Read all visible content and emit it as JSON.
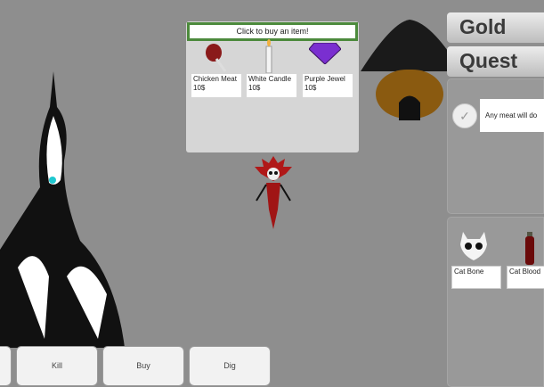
{
  "shop": {
    "title": "Click to buy an item!",
    "items": [
      {
        "label": "Chicken Meat 10$",
        "icon": "chicken-meat-icon"
      },
      {
        "label": "White Candle 10$",
        "icon": "white-candle-icon"
      },
      {
        "label": "Purple Jewel 10$",
        "icon": "purple-jewel-icon"
      }
    ]
  },
  "tabs": {
    "gold": "Gold",
    "quest": "Quest"
  },
  "quest": {
    "text": "Any meat will do",
    "icon": "checkmark-icon"
  },
  "inventory": [
    {
      "label": "Cat Bone",
      "icon": "cat-skull-icon"
    },
    {
      "label": "Cat Blood",
      "icon": "blood-vial-icon"
    }
  ],
  "actions": [
    {
      "label": ""
    },
    {
      "label": "Kill"
    },
    {
      "label": "Buy"
    },
    {
      "label": "Dig"
    }
  ],
  "colors": {
    "shop_border": "#4c8a3c",
    "background": "#8e8e8e",
    "jewel": "#7a2fd0"
  }
}
